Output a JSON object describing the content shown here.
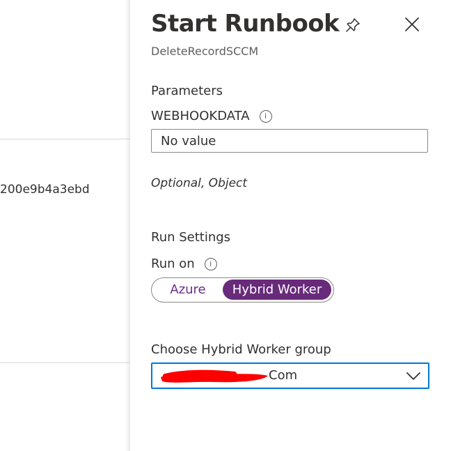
{
  "background": {
    "runbook_id_fragment": "200e9b4a3ebd"
  },
  "blade": {
    "title": "Start Runbook",
    "subtitle": "DeleteRecordSCCM",
    "icons": {
      "pin": "pin-icon",
      "close": "close-icon"
    }
  },
  "parameters": {
    "section_title": "Parameters",
    "field_label": "WEBHOOKDATA",
    "info_icon": "info-icon",
    "field_placeholder": "No value",
    "field_value": "",
    "hint": "Optional, Object"
  },
  "run_settings": {
    "section_title": "Run Settings",
    "run_on_label": "Run on",
    "info_icon": "info-icon",
    "options": [
      "Azure",
      "Hybrid Worker"
    ],
    "selected": "Hybrid Worker",
    "accent_color": "#682a7a"
  },
  "hybrid_worker": {
    "label": "Choose Hybrid Worker group",
    "selected_value_visible": "Com",
    "redacted": true,
    "redaction_color": "#ff0000",
    "focus_border_color": "#0078d4",
    "chevron_icon": "chevron-down-icon"
  }
}
